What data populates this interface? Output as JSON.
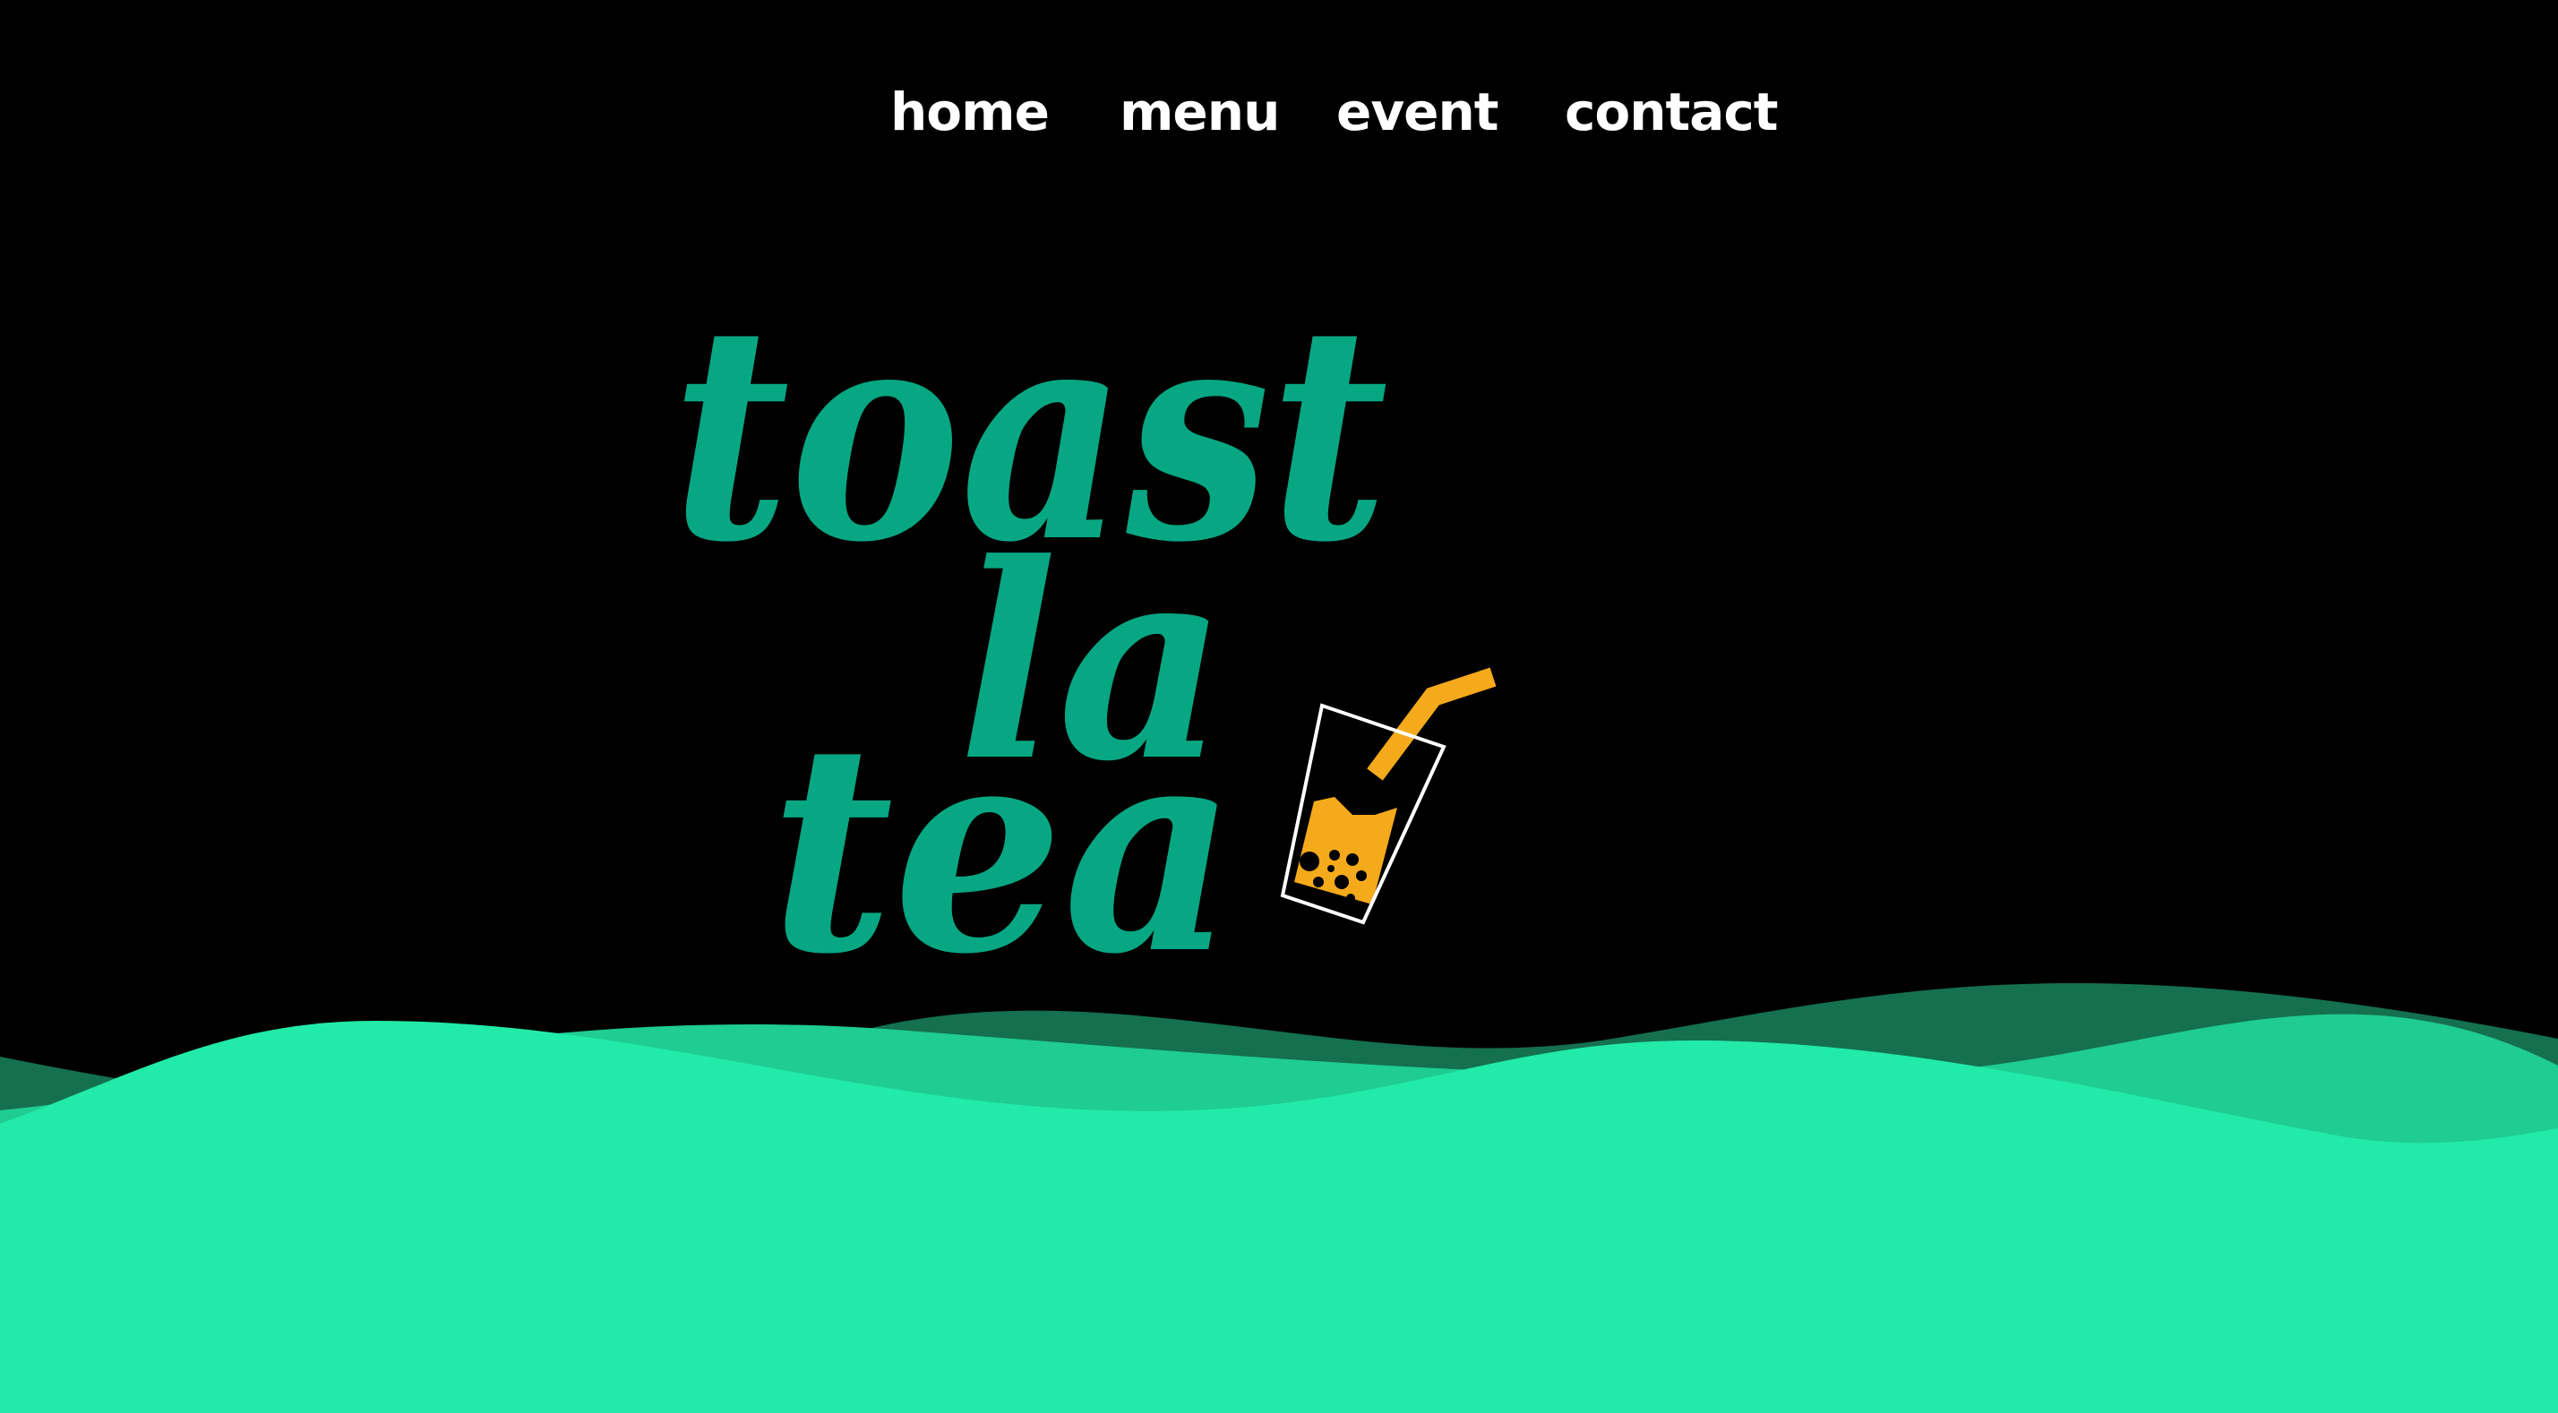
{
  "nav": {
    "items": [
      {
        "label": "home"
      },
      {
        "label": "menu"
      },
      {
        "label": "event"
      },
      {
        "label": "contact"
      }
    ]
  },
  "logo": {
    "lines": [
      "toast",
      "la",
      "tea"
    ]
  },
  "colors": {
    "background": "#000000",
    "logo_green": "#07a783",
    "wave_front": "#22eaa9",
    "wave_mid": "#1fcc92",
    "wave_back": "#14704f",
    "straw_orange": "#f5aa1c",
    "nav_text": "#ffffff"
  },
  "icons": {
    "logo_cup": "bubble-tea-cup-icon"
  }
}
